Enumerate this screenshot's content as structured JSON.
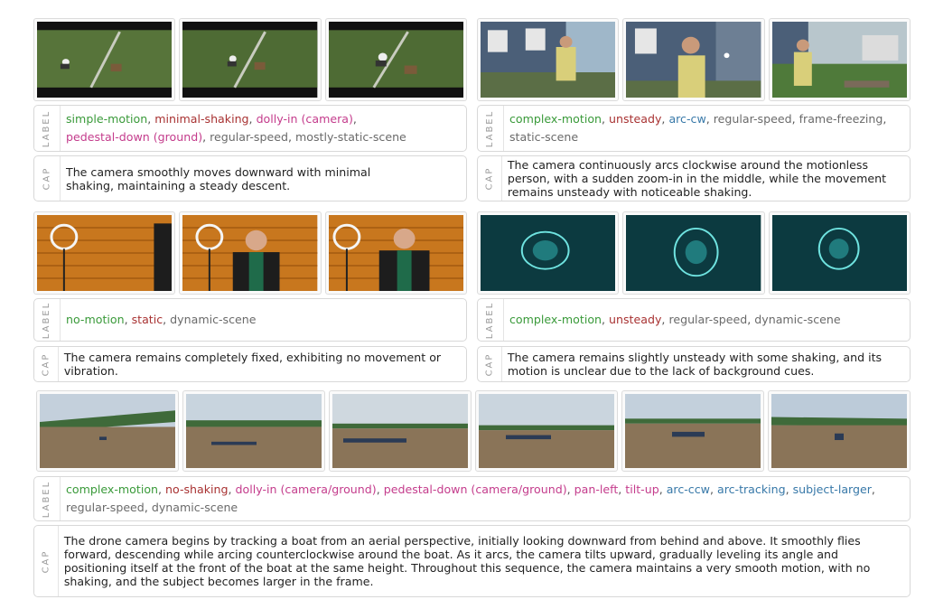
{
  "colors": {
    "green": "#3a9a3a",
    "red": "#a83232",
    "pink": "#c43c8c",
    "blue": "#3778a8",
    "gray": "#6a6a6a"
  },
  "tag_label": "LABEL",
  "tag_cap": "CAP",
  "panels": [
    {
      "frames": [
        "grass-field-frame-1",
        "grass-field-frame-2",
        "grass-field-frame-3"
      ],
      "labels": [
        {
          "text": "simple-motion",
          "color": "green"
        },
        {
          "text": "minimal-shaking",
          "color": "red"
        },
        {
          "text": "dolly-in (camera)",
          "color": "pink"
        },
        {
          "text": "pedestal-down (ground)",
          "color": "pink"
        },
        {
          "text": "regular-speed",
          "color": "gray"
        },
        {
          "text": "mostly-static-scene",
          "color": "gray"
        }
      ],
      "caption": "The camera smoothly moves downward with minimal shaking, maintaining a steady descent."
    },
    {
      "frames": [
        "house-man-frame-1",
        "house-man-frame-2",
        "house-man-frame-3"
      ],
      "labels": [
        {
          "text": "complex-motion",
          "color": "green"
        },
        {
          "text": "unsteady",
          "color": "red"
        },
        {
          "text": "arc-cw",
          "color": "blue"
        },
        {
          "text": "regular-speed",
          "color": "gray"
        },
        {
          "text": "frame-freezing",
          "color": "gray"
        },
        {
          "text": "static-scene",
          "color": "gray"
        }
      ],
      "caption": "The camera continuously arcs clockwise around the motionless person, with a sudden zoom-in in the middle, while the movement remains unsteady with noticeable shaking."
    },
    {
      "frames": [
        "ring-light-frame-1",
        "ring-light-frame-2",
        "ring-light-frame-3"
      ],
      "labels": [
        {
          "text": "no-motion",
          "color": "green"
        },
        {
          "text": "static",
          "color": "red"
        },
        {
          "text": "dynamic-scene",
          "color": "gray"
        }
      ],
      "caption": "The camera remains completely fixed, exhibiting no movement or vibration."
    },
    {
      "frames": [
        "jellyfish-frame-1",
        "jellyfish-frame-2",
        "jellyfish-frame-3"
      ],
      "labels": [
        {
          "text": "complex-motion",
          "color": "green"
        },
        {
          "text": "unsteady",
          "color": "red"
        },
        {
          "text": "regular-speed",
          "color": "gray"
        },
        {
          "text": "dynamic-scene",
          "color": "gray"
        }
      ],
      "caption": "The camera remains slightly unsteady with some shaking, and its motion is unclear due to the lack of background cues."
    },
    {
      "frames": [
        "river-boat-frame-1",
        "river-boat-frame-2",
        "river-boat-frame-3",
        "river-boat-frame-4",
        "river-boat-frame-5",
        "river-boat-frame-6"
      ],
      "labels": [
        {
          "text": "complex-motion",
          "color": "green"
        },
        {
          "text": "no-shaking",
          "color": "red"
        },
        {
          "text": "dolly-in (camera/ground)",
          "color": "pink"
        },
        {
          "text": "pedestal-down (camera/ground)",
          "color": "pink"
        },
        {
          "text": "pan-left",
          "color": "pink"
        },
        {
          "text": "tilt-up",
          "color": "pink"
        },
        {
          "text": "arc-ccw",
          "color": "blue"
        },
        {
          "text": "arc-tracking",
          "color": "blue"
        },
        {
          "text": "subject-larger",
          "color": "blue"
        },
        {
          "text": "regular-speed",
          "color": "gray"
        },
        {
          "text": "dynamic-scene",
          "color": "gray"
        }
      ],
      "caption": "The drone camera begins by tracking a boat from an aerial perspective, initially looking downward from behind and above. It smoothly flies forward, descending while arcing counterclockwise around the boat. As it arcs, the camera tilts upward, gradually leveling its angle and positioning itself at the front of the boat at the same height. Throughout this sequence, the camera maintains a very smooth motion, with no shaking, and the subject becomes larger in the frame."
    }
  ]
}
